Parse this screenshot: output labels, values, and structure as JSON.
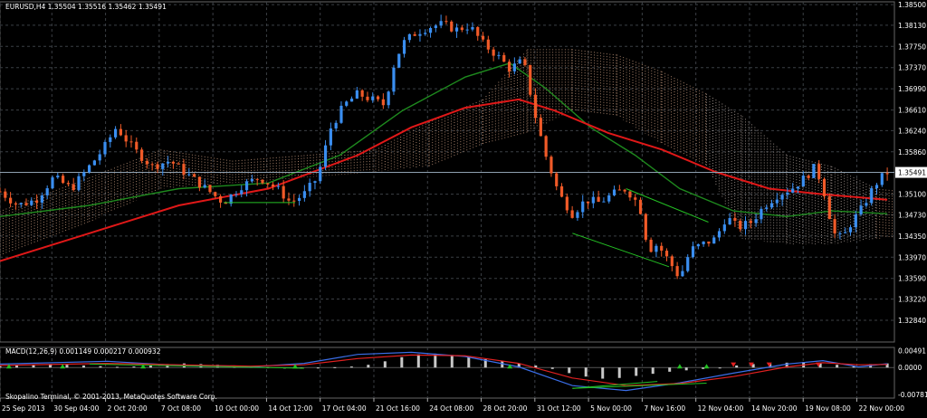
{
  "chart_data": {
    "type": "candlestick",
    "symbol_header": "EURUSD,H4  1.35504 1.35516 1.35462 1.35491",
    "copyright": "Skopalino Terminal, © 2001-2013, MetaQuotes Software Corp.",
    "current_price": 1.35491,
    "current_price_label": "1.35491",
    "colors": {
      "bull": "#3a8ef0",
      "bear": "#f05a28",
      "grid": "#3b3f44",
      "price_line": "#8fa0b0",
      "ma_fast": "#1e8a1e",
      "ma_slow": "#e01818",
      "cloud_bull": "#d9a98a",
      "cloud_bear": "#c8b8b0",
      "macd_hist": "#c8c8c8",
      "macd_line": "#3a6ee8",
      "macd_signal": "#e02020",
      "divergence": "#24c024"
    },
    "price_axis": {
      "ylim": [
        1.3245,
        1.3855
      ],
      "ticks": [
        {
          "value": 1.385,
          "label": "1.38500"
        },
        {
          "value": 1.3813,
          "label": "1.38130"
        },
        {
          "value": 1.3775,
          "label": "1.37750"
        },
        {
          "value": 1.3737,
          "label": "1.37370"
        },
        {
          "value": 1.3699,
          "label": "1.36990"
        },
        {
          "value": 1.3661,
          "label": "1.36610"
        },
        {
          "value": 1.3624,
          "label": "1.36240"
        },
        {
          "value": 1.3586,
          "label": "1.35860"
        },
        {
          "value": 1.351,
          "label": "1.35100"
        },
        {
          "value": 1.3473,
          "label": "1.34730"
        },
        {
          "value": 1.3435,
          "label": "1.34350"
        },
        {
          "value": 1.3397,
          "label": "1.33970"
        },
        {
          "value": 1.3359,
          "label": "1.33590"
        },
        {
          "value": 1.3322,
          "label": "1.33220"
        },
        {
          "value": 1.3284,
          "label": "1.32840"
        }
      ]
    },
    "time_axis": {
      "labels": [
        {
          "frac": 0.0,
          "label": "25 Sep 2013"
        },
        {
          "frac": 0.058,
          "label": "30 Sep 04:00"
        },
        {
          "frac": 0.118,
          "label": "2 Oct 20:00"
        },
        {
          "frac": 0.178,
          "label": "7 Oct 08:00"
        },
        {
          "frac": 0.238,
          "label": "10 Oct 00:00"
        },
        {
          "frac": 0.298,
          "label": "14 Oct 12:00"
        },
        {
          "frac": 0.358,
          "label": "17 Oct 04:00"
        },
        {
          "frac": 0.418,
          "label": "21 Oct 16:00"
        },
        {
          "frac": 0.478,
          "label": "24 Oct 08:00"
        },
        {
          "frac": 0.538,
          "label": "28 Oct 20:00"
        },
        {
          "frac": 0.598,
          "label": "31 Oct 12:00"
        },
        {
          "frac": 0.658,
          "label": "5 Nov 00:00"
        },
        {
          "frac": 0.718,
          "label": "7 Nov 16:00"
        },
        {
          "frac": 0.778,
          "label": "12 Nov 04:00"
        },
        {
          "frac": 0.838,
          "label": "14 Nov 20:00"
        },
        {
          "frac": 0.898,
          "label": "19 Nov 08:00"
        },
        {
          "frac": 0.958,
          "label": "22 Nov 00:00"
        }
      ]
    },
    "price_path": [
      [
        0.0,
        1.3515
      ],
      [
        0.02,
        1.349
      ],
      [
        0.04,
        1.35
      ],
      [
        0.06,
        1.354
      ],
      [
        0.08,
        1.352
      ],
      [
        0.1,
        1.356
      ],
      [
        0.115,
        1.359
      ],
      [
        0.13,
        1.363
      ],
      [
        0.15,
        1.359
      ],
      [
        0.17,
        1.356
      ],
      [
        0.19,
        1.357
      ],
      [
        0.21,
        1.3545
      ],
      [
        0.23,
        1.352
      ],
      [
        0.25,
        1.3495
      ],
      [
        0.27,
        1.3525
      ],
      [
        0.29,
        1.354
      ],
      [
        0.31,
        1.352
      ],
      [
        0.325,
        1.3495
      ],
      [
        0.34,
        1.351
      ],
      [
        0.355,
        1.354
      ],
      [
        0.37,
        1.363
      ],
      [
        0.385,
        1.367
      ],
      [
        0.4,
        1.369
      ],
      [
        0.415,
        1.368
      ],
      [
        0.43,
        1.367
      ],
      [
        0.44,
        1.374
      ],
      [
        0.45,
        1.378
      ],
      [
        0.465,
        1.38
      ],
      [
        0.48,
        1.381
      ],
      [
        0.495,
        1.3815
      ],
      [
        0.51,
        1.3805
      ],
      [
        0.525,
        1.3812
      ],
      [
        0.54,
        1.378
      ],
      [
        0.555,
        1.376
      ],
      [
        0.57,
        1.3735
      ],
      [
        0.585,
        1.375
      ],
      [
        0.6,
        1.364
      ],
      [
        0.61,
        1.358
      ],
      [
        0.625,
        1.351
      ],
      [
        0.64,
        1.3475
      ],
      [
        0.655,
        1.35
      ],
      [
        0.67,
        1.3495
      ],
      [
        0.685,
        1.351
      ],
      [
        0.7,
        1.352
      ],
      [
        0.715,
        1.349
      ],
      [
        0.725,
        1.341
      ],
      [
        0.735,
        1.342
      ],
      [
        0.748,
        1.339
      ],
      [
        0.76,
        1.336
      ],
      [
        0.772,
        1.341
      ],
      [
        0.785,
        1.342
      ],
      [
        0.8,
        1.343
      ],
      [
        0.812,
        1.347
      ],
      [
        0.825,
        1.345
      ],
      [
        0.84,
        1.346
      ],
      [
        0.855,
        1.349
      ],
      [
        0.87,
        1.351
      ],
      [
        0.885,
        1.352
      ],
      [
        0.9,
        1.354
      ],
      [
        0.912,
        1.356
      ],
      [
        0.922,
        1.351
      ],
      [
        0.932,
        1.344
      ],
      [
        0.942,
        1.343
      ],
      [
        0.952,
        1.346
      ],
      [
        0.962,
        1.348
      ],
      [
        0.972,
        1.351
      ],
      [
        0.982,
        1.3535
      ],
      [
        0.992,
        1.3549
      ]
    ],
    "ma_fast": [
      [
        0.0,
        1.347
      ],
      [
        0.1,
        1.349
      ],
      [
        0.2,
        1.352
      ],
      [
        0.3,
        1.353
      ],
      [
        0.38,
        1.358
      ],
      [
        0.45,
        1.366
      ],
      [
        0.52,
        1.372
      ],
      [
        0.57,
        1.3745
      ],
      [
        0.61,
        1.37
      ],
      [
        0.66,
        1.363
      ],
      [
        0.71,
        1.358
      ],
      [
        0.76,
        1.352
      ],
      [
        0.82,
        1.348
      ],
      [
        0.88,
        1.347
      ],
      [
        0.93,
        1.348
      ],
      [
        0.992,
        1.3475
      ]
    ],
    "ma_slow": [
      [
        0.0,
        1.339
      ],
      [
        0.1,
        1.344
      ],
      [
        0.2,
        1.349
      ],
      [
        0.3,
        1.352
      ],
      [
        0.4,
        1.358
      ],
      [
        0.46,
        1.363
      ],
      [
        0.52,
        1.3665
      ],
      [
        0.58,
        1.368
      ],
      [
        0.62,
        1.366
      ],
      [
        0.68,
        1.362
      ],
      [
        0.74,
        1.359
      ],
      [
        0.8,
        1.355
      ],
      [
        0.86,
        1.352
      ],
      [
        0.92,
        1.351
      ],
      [
        0.992,
        1.35
      ]
    ],
    "cloud_bounds": [
      [
        0.0,
        1.348,
        1.34
      ],
      [
        0.1,
        1.354,
        1.346
      ],
      [
        0.18,
        1.359,
        1.352
      ],
      [
        0.26,
        1.357,
        1.353
      ],
      [
        0.34,
        1.358,
        1.354
      ],
      [
        0.42,
        1.359,
        1.355
      ],
      [
        0.48,
        1.364,
        1.356
      ],
      [
        0.54,
        1.368,
        1.36
      ],
      [
        0.59,
        1.377,
        1.362
      ],
      [
        0.64,
        1.377,
        1.366
      ],
      [
        0.69,
        1.376,
        1.365
      ],
      [
        0.74,
        1.373,
        1.36
      ],
      [
        0.79,
        1.369,
        1.356
      ],
      [
        0.83,
        1.365,
        1.343
      ],
      [
        0.88,
        1.358,
        1.342
      ],
      [
        0.93,
        1.356,
        1.342
      ],
      [
        0.98,
        1.352,
        1.343
      ],
      [
        1.04,
        1.351,
        1.344
      ],
      [
        1.08,
        1.349,
        1.347
      ],
      [
        1.1,
        1.3485,
        1.3475
      ]
    ],
    "divergence_lines": [
      {
        "from": [
          0.25,
          1.3495
        ],
        "to": [
          0.33,
          1.3495
        ]
      },
      {
        "from": [
          0.64,
          1.344
        ],
        "to": [
          0.748,
          1.338
        ]
      },
      {
        "from": [
          0.7,
          1.352
        ],
        "to": [
          0.792,
          1.346
        ]
      }
    ],
    "macd_panel": {
      "title": "MACD(12,26,9) 0.001149 0.000217 0.000932",
      "ticks": [
        {
          "value": 0.0049,
          "label": "0.00491"
        },
        {
          "value": 0.0,
          "label": "0.0000"
        },
        {
          "value": -0.0078,
          "label": "-0.00781"
        }
      ],
      "ylim": [
        -0.0088,
        0.0058
      ],
      "histogram": [
        0.0004,
        0.0006,
        0.0008,
        0.001,
        0.0008,
        0.0006,
        0.0004,
        0.0002,
        0.0003,
        0.0006,
        0.001,
        0.0012,
        0.001,
        0.0008,
        0.0006,
        0.0003,
        0.0001,
        -0.0001,
        -0.0002,
        -0.0001,
        0.0001,
        0.0003,
        0.0008,
        0.0018,
        0.003,
        0.0038,
        0.004,
        0.0036,
        0.003,
        0.0024,
        0.0018,
        0.0012,
        0.0006,
        -0.0004,
        -0.0016,
        -0.0026,
        -0.0032,
        -0.003,
        -0.0024,
        -0.0018,
        -0.0012,
        -0.0008,
        -0.0004,
        0.0,
        0.0006,
        0.001,
        0.0012,
        0.0014,
        0.0016,
        0.0012,
        0.0008,
        0.0004,
        0.001,
        0.0012
      ],
      "macd_line": [
        [
          0.0,
          0.001
        ],
        [
          0.12,
          0.0018
        ],
        [
          0.2,
          0.0006
        ],
        [
          0.28,
          0.0002
        ],
        [
          0.34,
          0.0012
        ],
        [
          0.4,
          0.0038
        ],
        [
          0.46,
          0.0044
        ],
        [
          0.52,
          0.0032
        ],
        [
          0.58,
          0.0002
        ],
        [
          0.64,
          -0.0052
        ],
        [
          0.7,
          -0.0066
        ],
        [
          0.76,
          -0.0044
        ],
        [
          0.82,
          -0.0016
        ],
        [
          0.88,
          0.001
        ],
        [
          0.92,
          0.002
        ],
        [
          0.96,
          0.0002
        ],
        [
          0.992,
          0.0011
        ]
      ],
      "signal_line": [
        [
          0.0,
          0.0006
        ],
        [
          0.12,
          0.0012
        ],
        [
          0.2,
          0.0008
        ],
        [
          0.28,
          0.0004
        ],
        [
          0.34,
          0.0008
        ],
        [
          0.4,
          0.0026
        ],
        [
          0.46,
          0.0036
        ],
        [
          0.52,
          0.0034
        ],
        [
          0.58,
          0.0012
        ],
        [
          0.64,
          -0.003
        ],
        [
          0.7,
          -0.0052
        ],
        [
          0.76,
          -0.0046
        ],
        [
          0.82,
          -0.0026
        ],
        [
          0.88,
          0.0002
        ],
        [
          0.92,
          0.0014
        ],
        [
          0.96,
          0.0008
        ],
        [
          0.992,
          0.0009
        ]
      ],
      "divergence_lines": [
        {
          "from": [
            0.64,
            -0.006
          ],
          "to": [
            0.735,
            -0.004
          ]
        },
        {
          "from": [
            0.64,
            -0.006
          ],
          "to": [
            0.79,
            -0.0045
          ]
        },
        {
          "from": [
            0.1,
            0.001
          ],
          "to": [
            0.34,
            -0.0002
          ]
        }
      ],
      "bull_arrows": [
        0.01,
        0.07,
        0.16,
        0.33,
        0.57,
        0.76,
        0.79
      ],
      "bear_arrows": [
        0.82,
        0.84,
        0.86,
        0.915
      ]
    }
  }
}
